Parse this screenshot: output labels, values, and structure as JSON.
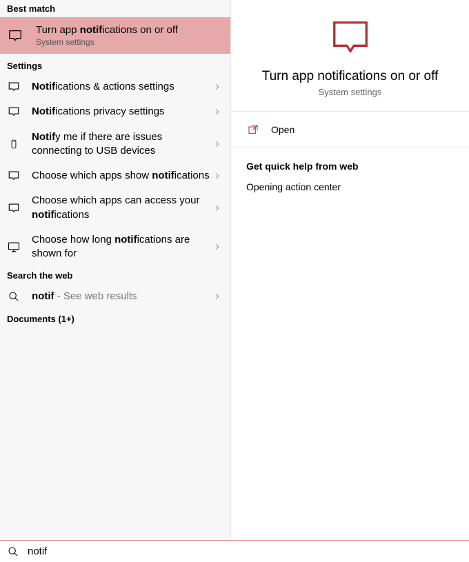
{
  "sections": {
    "best_match": "Best match",
    "settings": "Settings",
    "search_web": "Search the web",
    "documents": "Documents (1+)"
  },
  "best_match_item": {
    "title_pre": "Turn app ",
    "title_bold": "notif",
    "title_post": "ications on or off",
    "sub": "System settings"
  },
  "settings_items": [
    {
      "pre": "",
      "bold": "Notif",
      "post": "ications & actions settings",
      "icon": "chat"
    },
    {
      "pre": "",
      "bold": "Notif",
      "post": "ications privacy settings",
      "icon": "chat"
    },
    {
      "pre": "",
      "bold": "Notif",
      "post": "y me if there are issues connecting to USB devices",
      "icon": "usb"
    },
    {
      "pre": "Choose which apps show ",
      "bold": "notif",
      "post": "ications",
      "icon": "chat"
    },
    {
      "pre": "Choose which apps can access your ",
      "bold": "notif",
      "post": "ications",
      "icon": "chat"
    },
    {
      "pre": "Choose how long ",
      "bold": "notif",
      "post": "ications are shown for",
      "icon": "monitor"
    }
  ],
  "web_item": {
    "bold": "notif",
    "sub": " - See web results"
  },
  "right": {
    "title": "Turn app notifications on or off",
    "sub": "System settings",
    "open": "Open",
    "help_title": "Get quick help from web",
    "help_link": "Opening action center"
  },
  "search": {
    "value": "notif"
  },
  "colors": {
    "accent": "#b53133",
    "highlight": "#e6a8a8"
  }
}
